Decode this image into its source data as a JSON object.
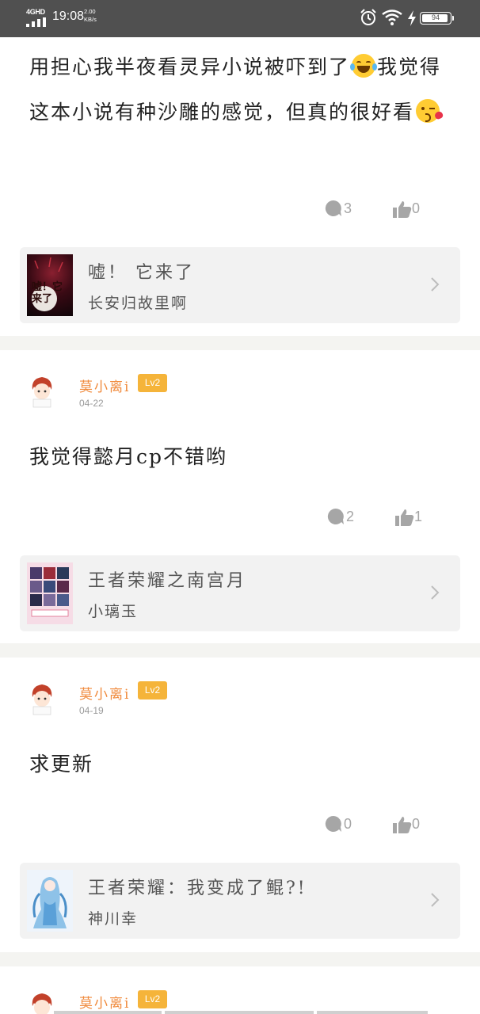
{
  "status_bar": {
    "network": "4GHD",
    "time": "19:08",
    "speed_value": "2.00",
    "speed_unit": "KB/s",
    "battery": "94",
    "icons": [
      "signal-icon",
      "alarm-icon",
      "wifi-icon",
      "charging-icon",
      "battery-icon"
    ]
  },
  "posts": [
    {
      "text_parts": [
        "用担心我半夜看灵异小说被吓到了",
        "我觉得这本小说有种沙雕的感觉，但真的很好看"
      ],
      "emojis": [
        "laughing-crying-emoji",
        "kiss-emoji"
      ],
      "comments": "3",
      "likes": "0",
      "book": {
        "title": "嘘！ 它来了",
        "author": "长安归故里啊",
        "cover_text": "嘘！它来了"
      }
    },
    {
      "user": "莫小离i",
      "level": "Lv2",
      "date": "04-22",
      "text": "我觉得懿月cp不错哟",
      "comments": "2",
      "likes": "1",
      "book": {
        "title": "王者荣耀之南宫月",
        "author": "小璃玉"
      }
    },
    {
      "user": "莫小离i",
      "level": "Lv2",
      "date": "04-19",
      "text": "求更新",
      "comments": "0",
      "likes": "0",
      "book": {
        "title": "王者荣耀：我变成了鲲?!",
        "author": "神川幸"
      }
    },
    {
      "user": "莫小离i",
      "level": "Lv2"
    }
  ],
  "colors": {
    "status_bar": "#505050",
    "username": "#f08a3c",
    "level_badge": "#f5b43a",
    "card_bg": "#f2f2f2",
    "divider": "#f4f4f1",
    "action_gray": "#a6a6a6"
  }
}
